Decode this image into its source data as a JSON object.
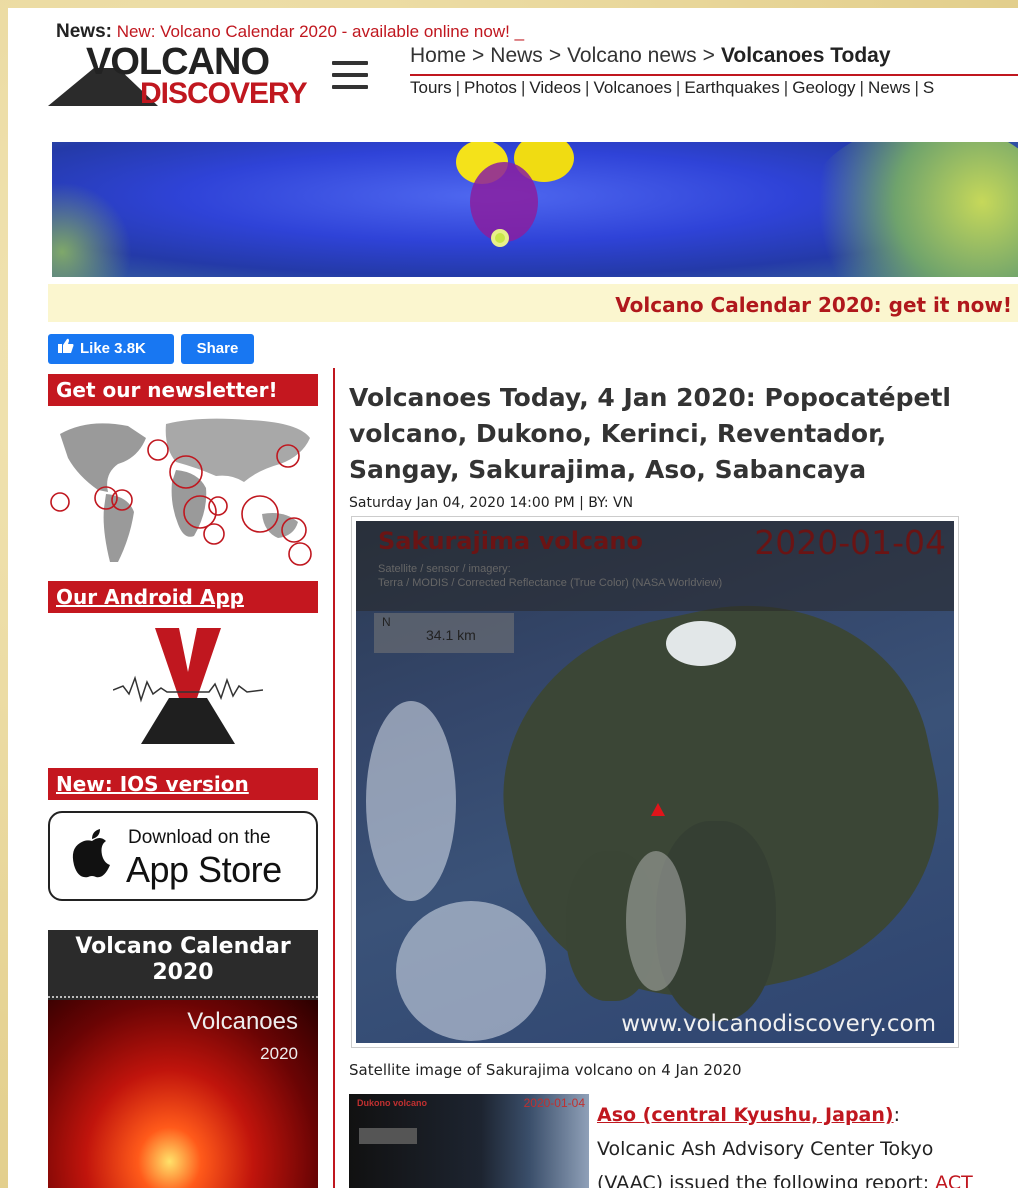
{
  "news": {
    "label": "News:",
    "text": "New: Volcano Calendar 2020 - available online now! _"
  },
  "logo": {
    "line1": "VOLCANO",
    "line2": "DISCOVERY"
  },
  "breadcrumb": {
    "items": [
      "Home",
      "News",
      "Volcano news"
    ],
    "current": "Volcanoes Today",
    "separator": ">"
  },
  "topnav": {
    "items": [
      "Tours",
      "Photos",
      "Videos",
      "Volcanoes",
      "Earthquakes",
      "Geology",
      "News",
      "S"
    ]
  },
  "calendar_strip": {
    "text": "Volcano Calendar 2020: get it now!"
  },
  "social": {
    "like_label": "Like 3.8K",
    "share_label": "Share"
  },
  "sidebar": {
    "newsletter": "Get our newsletter!",
    "android": "Our Android App",
    "ios": "New: IOS version",
    "appstore": {
      "small": "Download on the",
      "big": "App Store"
    },
    "calendar": {
      "title": "Volcano Calendar 2020",
      "cover_title": "Volcanoes",
      "cover_year": "2020"
    }
  },
  "article": {
    "title": "Volcanoes Today, 4 Jan 2020: Popocatépetl volcano, Dukono, Kerinci, Reventador, Sangay, Sakurajima, Aso, Sabancaya",
    "byline": "Saturday Jan 04, 2020 14:00 PM | BY: VN",
    "figure": {
      "volcano": "Sakurajima volcano",
      "date": "2020-01-04",
      "source1": "Satellite / sensor / imagery:",
      "source2": "Terra / MODIS / Corrected Reflectance (True Color) (NASA Worldview)",
      "north": "N",
      "scale": "34.1 km",
      "watermark": "www.volcanodiscovery.com"
    },
    "caption": "Satellite image of Sakurajima volcano on 4 Jan 2020",
    "thumb": {
      "title": "Dukono volcano",
      "date": "2020-01-04"
    },
    "entry": {
      "link": "Aso (central Kyushu, Japan)",
      "colon": ":",
      "text1": "Volcanic Ash Advisory Center Tokyo",
      "text2": "(VAAC) issued the following report:",
      "act": "ACT"
    }
  },
  "colors": {
    "accent": "#c0171f",
    "facebook": "#1877f2",
    "strip": "#fbf6cf"
  }
}
